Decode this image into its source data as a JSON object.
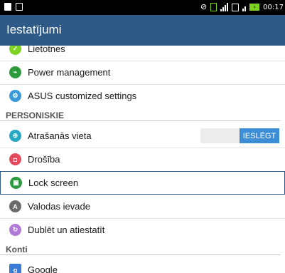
{
  "status": {
    "time": "00:17",
    "battery": "charging",
    "signal": "4 bars"
  },
  "app": {
    "title": "Iestatījumi"
  },
  "items": [
    {
      "label": "Lietotnes",
      "icon": "apps-icon",
      "color": "#7ed321"
    },
    {
      "label": "Power management",
      "icon": "power-management-icon",
      "color": "#2e9a3e"
    },
    {
      "label": "ASUS customized settings",
      "icon": "asus-settings-icon",
      "color": "#3a9ad9"
    }
  ],
  "sections": [
    {
      "title": "PERSONISKIE"
    },
    {
      "title": "Konti"
    }
  ],
  "personal": [
    {
      "label": "Atrašanās vieta",
      "icon": "location-icon",
      "color": "#26a8c2",
      "toggle": "IESLĒGT"
    },
    {
      "label": "Drošība",
      "icon": "lock-icon",
      "color": "#e54b5f"
    },
    {
      "label": "Lock screen",
      "icon": "lock-screen-icon",
      "color": "#2e9a3e"
    },
    {
      "label": "Valodas ievade",
      "icon": "language-icon",
      "color": "#6b6b6b"
    },
    {
      "label": "Dublēt un atiestatīt",
      "icon": "backup-icon",
      "color": "#b07ad6"
    }
  ],
  "accounts": [
    {
      "label": "Google",
      "icon": "google-icon",
      "color": "#3a7bd5"
    }
  ],
  "colors": {
    "appbar": "#2d5a86",
    "statusbar": "#000000",
    "toggle_on": "#3c8fd6"
  }
}
